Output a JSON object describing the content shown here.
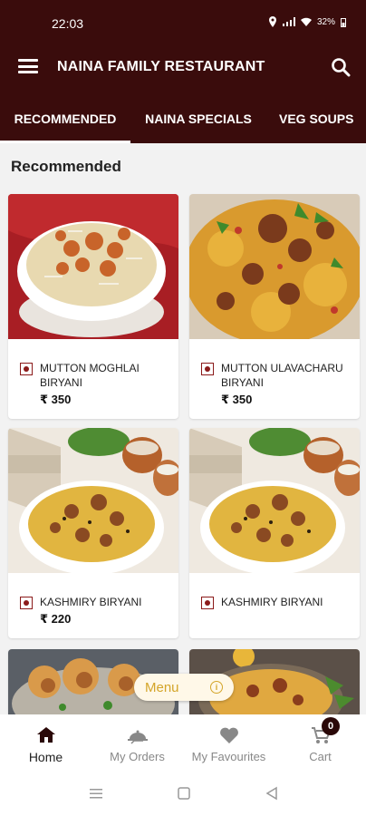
{
  "status": {
    "time": "22:03",
    "battery": "32%"
  },
  "app": {
    "title": "NAINA FAMILY RESTAURANT"
  },
  "tabs": [
    {
      "label": "RECOMMENDED",
      "active": true
    },
    {
      "label": "NAINA SPECIALS",
      "active": false
    },
    {
      "label": "VEG SOUPS",
      "active": false
    }
  ],
  "section": {
    "title": "Recommended"
  },
  "items": [
    {
      "name": "MUTTON MOGHLAI BIRYANI",
      "price": "₹ 350",
      "veg_mark_color": "#8b1a1a"
    },
    {
      "name": "MUTTON ULAVACHARU BIRYANI",
      "price": "₹ 350",
      "veg_mark_color": "#8b1a1a"
    },
    {
      "name": "KASHMIRY BIRYANI",
      "price": "₹ 220",
      "veg_mark_color": "#8b1a1a"
    },
    {
      "name": "KASHMIRY BIRYANI",
      "price": "",
      "veg_mark_color": "#8b1a1a"
    }
  ],
  "menu_fab": {
    "label": "Menu"
  },
  "bottom_nav": [
    {
      "label": "Home",
      "icon": "home-icon",
      "active": true
    },
    {
      "label": "My Orders",
      "icon": "orders-icon",
      "active": false
    },
    {
      "label": "My Favourites",
      "icon": "heart-icon",
      "active": false
    },
    {
      "label": "Cart",
      "icon": "cart-icon",
      "active": false,
      "badge": "0"
    }
  ],
  "colors": {
    "primary": "#3a0c0c",
    "accent": "#d4a52a",
    "background": "#f2f2f2"
  }
}
